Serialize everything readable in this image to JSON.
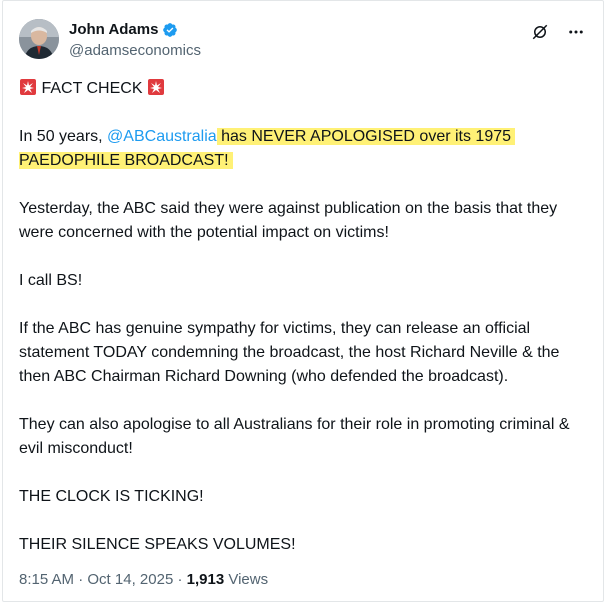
{
  "author": {
    "name": "John Adams",
    "handle": "@adamseconomics"
  },
  "tweet": {
    "fact_check": "FACT CHECK",
    "p1_prefix": "In 50 years, ",
    "mention": "@ABCaustralia",
    "p1_highlight_line1": " has NEVER APOLOGISED over its 1975",
    "p1_highlight_line2": "PAEDOPHILE BROADCAST!",
    "p2": "Yesterday, the ABC said they were against publication on the basis that they were concerned with the potential impact on victims!",
    "p3": "I call BS!",
    "p4": "If the ABC has genuine sympathy for victims, they can release an official statement TODAY condemning the broadcast, the host Richard Neville & the then ABC Chairman Richard Downing (who defended the broadcast).",
    "p5": "They can also apologise to all Australians for their role in promoting criminal & evil misconduct!",
    "p6": "THE CLOCK IS TICKING!",
    "p7": "THEIR SILENCE SPEAKS VOLUMES!"
  },
  "meta": {
    "time": "8:15 AM",
    "date": "Oct 14, 2025",
    "views_count": "1,913",
    "views_label": "Views",
    "separator": "·"
  },
  "icons": {
    "verified": "verified-badge-icon",
    "grok": "grok-icon",
    "more": "more-icon",
    "siren": "siren-icon"
  },
  "colors": {
    "accent": "#1d9bf0",
    "highlight": "#fff176",
    "muted": "#536471"
  }
}
